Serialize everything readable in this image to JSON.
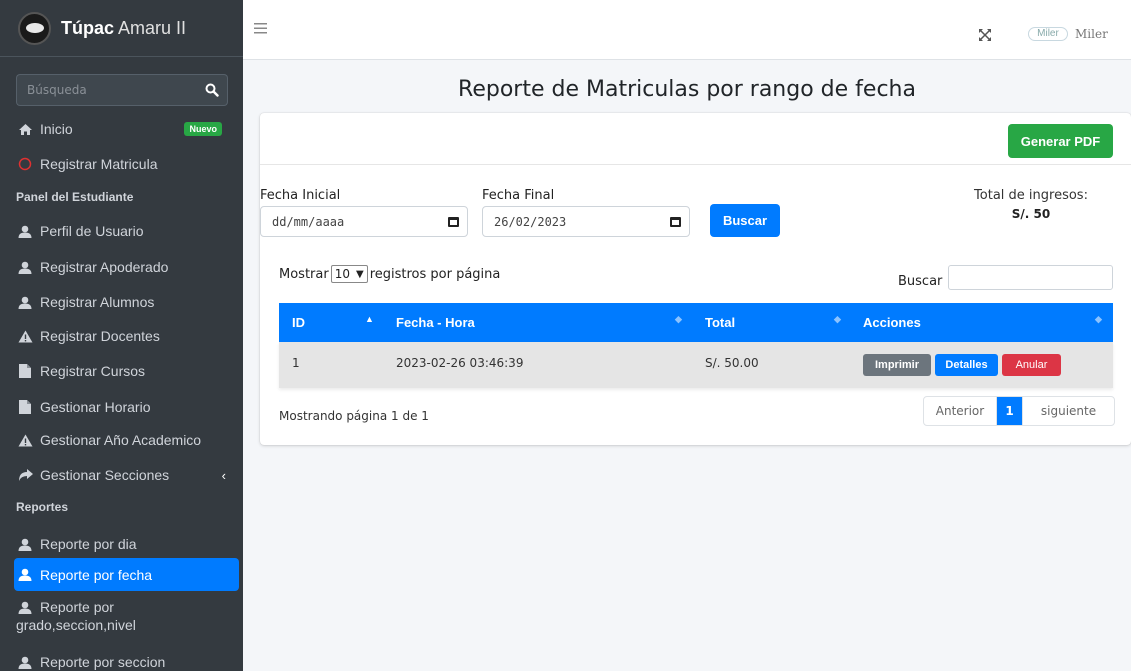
{
  "brand": {
    "bold": "Túpac",
    "rest": " Amaru II"
  },
  "sidebar": {
    "search_placeholder": "Búsqueda",
    "items": [
      {
        "label": "Inicio",
        "badge": "Nuevo"
      },
      {
        "label": "Registrar Matricula"
      },
      {
        "header": "Panel del Estudiante"
      },
      {
        "label": "Perfil de Usuario"
      },
      {
        "label": "Registrar Apoderado"
      },
      {
        "label": "Registrar Alumnos"
      },
      {
        "label": "Registrar Docentes"
      },
      {
        "label": "Registrar Cursos"
      },
      {
        "label": "Gestionar Horario"
      },
      {
        "label": "Gestionar Año Academico"
      },
      {
        "label": "Gestionar Secciones"
      },
      {
        "header": "Reportes"
      },
      {
        "label": "Reporte por dia"
      },
      {
        "label": "Reporte por fecha"
      },
      {
        "label_line1": "Reporte por",
        "label_line2": "grado,seccion,nivel"
      },
      {
        "label": "Reporte por seccion"
      }
    ]
  },
  "topbar": {
    "user_image_alt": "Miler",
    "user_name": "Miler"
  },
  "page": {
    "title": "Reporte de Matriculas por rango de fecha"
  },
  "toolbar": {
    "pdf_label": "Generar PDF"
  },
  "filters": {
    "start_label": "Fecha Inicial",
    "start_value": "dd/mm/aaaa",
    "end_label": "Fecha Final",
    "end_value": "26/02/2023",
    "search_label": "Buscar"
  },
  "totals": {
    "label": "Total de ingresos:",
    "value": "S/. 50"
  },
  "table": {
    "length_prefix": "Mostrar",
    "length_value": "10",
    "length_suffix": "registros por página",
    "filter_label": "Buscar",
    "columns": [
      "ID",
      "Fecha - Hora",
      "Total",
      "Acciones"
    ],
    "rows": [
      {
        "id": "1",
        "fecha": "2023-02-26 03:46:39",
        "total": "S/. 50.00",
        "actions": [
          "Imprimir",
          "Detalles",
          "Anular"
        ]
      }
    ],
    "info": "Mostrando página 1 de 1",
    "pagination": {
      "prev": "Anterior",
      "current": "1",
      "next": "siguiente"
    }
  },
  "colors": {
    "primary": "#007bff",
    "success": "#28a745",
    "danger": "#dc3545",
    "secondary": "#6c757d",
    "sidebar": "#343a40"
  }
}
